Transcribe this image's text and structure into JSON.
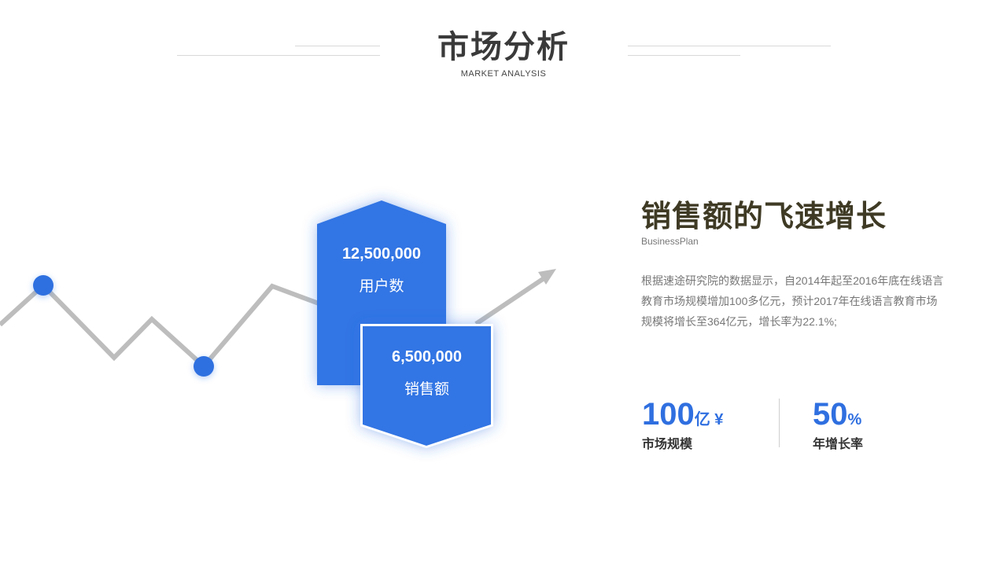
{
  "header": {
    "title": "市场分析",
    "subtitle": "MARKET ANALYSIS"
  },
  "shields": {
    "users": {
      "value": "12,500,000",
      "label": "用户数"
    },
    "sales": {
      "value": "6,500,000",
      "label": "销售额"
    }
  },
  "content": {
    "title": "销售额的飞速增长",
    "subtitle": "BusinessPlan",
    "description": "根据速途研究院的数据显示，自2014年起至2016年底在线语言教育市场规模增加100多亿元，预计2017年在线语言教育市场规模将增长至364亿元，增长率为22.1%;"
  },
  "stats": [
    {
      "value": "100",
      "unit": "亿 ¥",
      "caption": "市场规模"
    },
    {
      "value": "50",
      "unit": "%",
      "caption": "年增长率"
    }
  ],
  "colors": {
    "accent": "#2f6fe0",
    "line": "#bdbdbd",
    "title": "#3e3a24"
  },
  "icons": [
    "trend-arrow-icon",
    "data-point-icon"
  ]
}
